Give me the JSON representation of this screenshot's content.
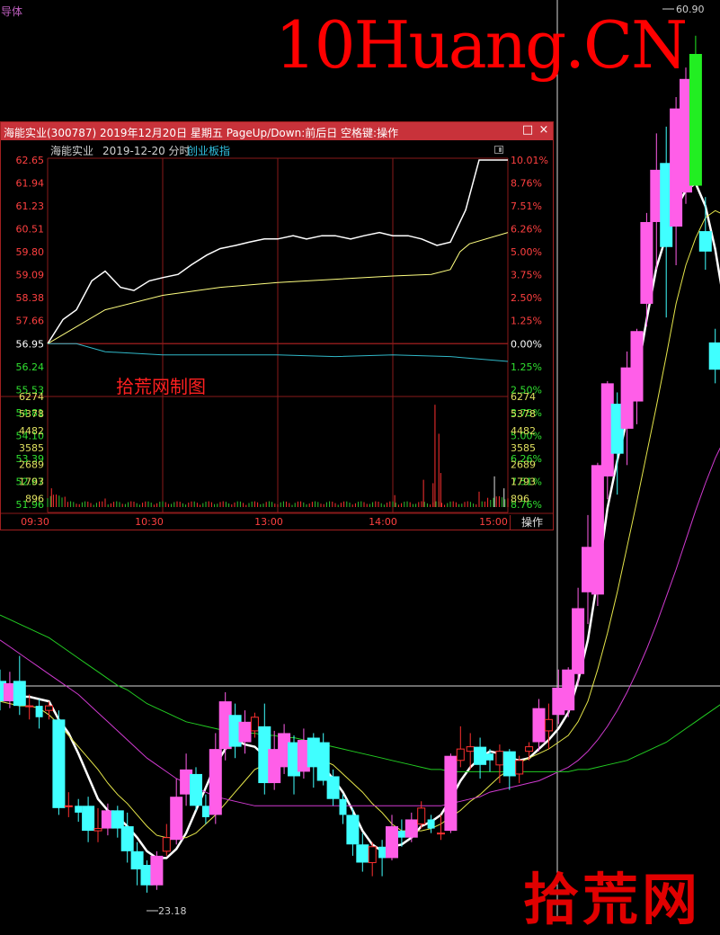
{
  "colors": {
    "up": "#ff3030",
    "down": "#40ffff",
    "big_up": "#ff5ee8",
    "big_down": "#22ee22",
    "ma5": "#ffffff",
    "ma10": "#e6e64a",
    "ma20": "#d03ad0",
    "ma60": "#22cc22",
    "grid": "#8a1a1a",
    "price_line": "#ffffff",
    "avg_line": "#ffff80",
    "index_line": "#30b8c8",
    "up_text": "#ff4040",
    "down_text": "#30e030",
    "neutral_text": "#ffffff",
    "volume_text": "#e0e060"
  },
  "kline": {
    "sector_tag": "导体",
    "max_label": "60.90",
    "min_label": "23.18"
  },
  "watermarks": {
    "top": "10Huang.CN",
    "bottom": "拾荒网"
  },
  "popup": {
    "title": "海能实业(300787) 2019年12月20日 星期五 PageUp/Down:前后日 空格键:操作",
    "stock_name": "海能实业",
    "date": "2019-12-20 分时",
    "index_link": "创业板指",
    "restore_icon": "□",
    "close_icon": "×",
    "stamp": "拾荒网制图",
    "operate_label": "操作",
    "price_axis": [
      "62.65",
      "61.94",
      "61.23",
      "60.51",
      "59.80",
      "59.09",
      "58.38",
      "57.66",
      "56.95",
      "56.24",
      "55.53",
      "54.81",
      "54.10",
      "53.39",
      "52.67",
      "51.96"
    ],
    "pct_axis": [
      "10.01%",
      "8.76%",
      "7.51%",
      "6.26%",
      "5.00%",
      "3.75%",
      "2.50%",
      "1.25%",
      "0.00%",
      "1.25%",
      "2.50%",
      "3.75%",
      "5.00%",
      "6.26%",
      "7.51%",
      "8.76%"
    ],
    "volume_axis": [
      "6274",
      "5378",
      "4482",
      "3585",
      "2689",
      "1793",
      "896"
    ],
    "time_axis": [
      "09:30",
      "10:30",
      "13:00",
      "14:00",
      "15:00"
    ]
  },
  "chart_data": [
    {
      "type": "line",
      "title": "海能实业 2019-12-20 分时",
      "series": [
        {
          "name": "price",
          "x": [
            0,
            8,
            15,
            23,
            30,
            38,
            45,
            53,
            60,
            68,
            75,
            83,
            90,
            98,
            105,
            113,
            120,
            128,
            135,
            143,
            150,
            158,
            165,
            173,
            180,
            188,
            195,
            203,
            210,
            218,
            225,
            233,
            240
          ],
          "values": [
            56.95,
            57.7,
            58.0,
            58.9,
            59.2,
            58.7,
            58.6,
            58.9,
            59.0,
            59.1,
            59.4,
            59.7,
            59.9,
            60.0,
            60.1,
            60.2,
            60.2,
            60.3,
            60.2,
            60.3,
            60.3,
            60.2,
            60.3,
            60.4,
            60.3,
            60.3,
            60.2,
            60.0,
            60.1,
            61.1,
            62.65,
            62.65,
            62.65
          ]
        },
        {
          "name": "avg",
          "x": [
            0,
            30,
            60,
            90,
            120,
            150,
            180,
            200,
            210,
            215,
            220,
            240
          ],
          "values": [
            56.95,
            58.0,
            58.45,
            58.7,
            58.85,
            58.95,
            59.05,
            59.1,
            59.25,
            59.8,
            60.05,
            60.4
          ]
        },
        {
          "name": "index",
          "x": [
            0,
            15,
            30,
            60,
            90,
            120,
            150,
            180,
            210,
            240
          ],
          "values": [
            56.95,
            56.95,
            56.7,
            56.6,
            56.6,
            56.6,
            56.55,
            56.6,
            56.55,
            56.4
          ]
        }
      ],
      "xlabel": "",
      "ylabel": "",
      "ylim": [
        51.25,
        62.65
      ]
    },
    {
      "type": "bar",
      "title": "",
      "xlim": [
        0,
        240
      ],
      "ylim": [
        0,
        6274
      ],
      "spikes": [
        {
          "x": 201,
          "v": 1400
        },
        {
          "x": 202,
          "v": 6000
        },
        {
          "x": 204,
          "v": 4300
        },
        {
          "x": 196,
          "v": 1600
        },
        {
          "x": 205,
          "v": 2000
        },
        {
          "x": 233,
          "v": 1800
        },
        {
          "x": 238,
          "v": 1100
        },
        {
          "x": 2,
          "v": 1100
        },
        {
          "x": 30,
          "v": 500
        },
        {
          "x": 181,
          "v": 700
        },
        {
          "x": 225,
          "v": 900
        }
      ]
    },
    {
      "type": "candlestick",
      "title": "",
      "ylim": [
        22.5,
        62.0
      ],
      "candles": [
        {
          "o": 32.5,
          "c": 31.6,
          "h": 33.0,
          "l": 31.2
        },
        {
          "o": 31.6,
          "c": 32.4,
          "h": 32.9,
          "l": 31.3
        },
        {
          "o": 32.5,
          "c": 31.4,
          "h": 33.6,
          "l": 31.0
        },
        {
          "o": 31.4,
          "c": 31.4,
          "h": 31.9,
          "l": 30.8
        },
        {
          "o": 31.4,
          "c": 30.9,
          "h": 31.7,
          "l": 30.4
        },
        {
          "o": 31.2,
          "c": 31.4,
          "h": 31.6,
          "l": 30.8
        },
        {
          "o": 30.8,
          "c": 26.9,
          "h": 31.2,
          "l": 26.6
        },
        {
          "o": 27.0,
          "c": 27.0,
          "h": 27.6,
          "l": 26.5
        },
        {
          "o": 27.0,
          "c": 26.7,
          "h": 27.3,
          "l": 26.3
        },
        {
          "o": 27.0,
          "c": 25.9,
          "h": 27.4,
          "l": 25.4
        },
        {
          "o": 25.9,
          "c": 26.0,
          "h": 26.9,
          "l": 25.4
        },
        {
          "o": 26.0,
          "c": 26.8,
          "h": 27.1,
          "l": 25.7
        },
        {
          "o": 26.8,
          "c": 26.0,
          "h": 27.0,
          "l": 25.6
        },
        {
          "o": 26.1,
          "c": 25.0,
          "h": 26.7,
          "l": 24.5
        },
        {
          "o": 25.0,
          "c": 24.2,
          "h": 25.4,
          "l": 23.5
        },
        {
          "o": 24.4,
          "c": 23.5,
          "h": 24.6,
          "l": 23.18
        },
        {
          "o": 23.5,
          "c": 24.8,
          "h": 25.0,
          "l": 23.3
        },
        {
          "o": 25.0,
          "c": 25.6,
          "h": 26.2,
          "l": 24.8
        },
        {
          "o": 25.5,
          "c": 27.4,
          "h": 28.2,
          "l": 25.3
        },
        {
          "o": 27.5,
          "c": 28.6,
          "h": 29.3,
          "l": 27.0
        },
        {
          "o": 28.4,
          "c": 27.0,
          "h": 28.7,
          "l": 26.8
        },
        {
          "o": 27.0,
          "c": 26.5,
          "h": 27.5,
          "l": 26.2
        },
        {
          "o": 26.6,
          "c": 29.5,
          "h": 30.2,
          "l": 26.2
        },
        {
          "o": 29.5,
          "c": 31.6,
          "h": 32.0,
          "l": 29.0
        },
        {
          "o": 31.0,
          "c": 29.6,
          "h": 31.5,
          "l": 29.1
        },
        {
          "o": 29.8,
          "c": 30.7,
          "h": 31.2,
          "l": 29.3
        },
        {
          "o": 30.3,
          "c": 30.9,
          "h": 31.1,
          "l": 30.0
        },
        {
          "o": 30.5,
          "c": 28.0,
          "h": 31.5,
          "l": 27.5
        },
        {
          "o": 28.0,
          "c": 29.5,
          "h": 30.3,
          "l": 27.7
        },
        {
          "o": 28.7,
          "c": 30.2,
          "h": 30.6,
          "l": 28.4
        },
        {
          "o": 29.8,
          "c": 28.3,
          "h": 30.1,
          "l": 27.5
        },
        {
          "o": 28.5,
          "c": 29.9,
          "h": 30.4,
          "l": 28.2
        },
        {
          "o": 30.0,
          "c": 28.7,
          "h": 30.2,
          "l": 27.8
        },
        {
          "o": 29.8,
          "c": 28.1,
          "h": 30.2,
          "l": 27.9
        },
        {
          "o": 28.3,
          "c": 27.3,
          "h": 28.6,
          "l": 27.0
        },
        {
          "o": 27.3,
          "c": 26.6,
          "h": 27.5,
          "l": 26.2
        },
        {
          "o": 26.6,
          "c": 25.3,
          "h": 26.9,
          "l": 24.8
        },
        {
          "o": 25.3,
          "c": 24.5,
          "h": 25.8,
          "l": 24.1
        },
        {
          "o": 24.5,
          "c": 25.2,
          "h": 25.4,
          "l": 23.9
        },
        {
          "o": 25.2,
          "c": 24.7,
          "h": 25.5,
          "l": 23.9
        },
        {
          "o": 24.7,
          "c": 26.1,
          "h": 26.6,
          "l": 24.6
        },
        {
          "o": 25.9,
          "c": 25.6,
          "h": 26.4,
          "l": 25.2
        },
        {
          "o": 25.6,
          "c": 26.4,
          "h": 26.7,
          "l": 25.4
        },
        {
          "o": 26.2,
          "c": 26.9,
          "h": 27.2,
          "l": 26.0
        },
        {
          "o": 26.4,
          "c": 26.0,
          "h": 26.6,
          "l": 25.8
        },
        {
          "o": 25.8,
          "c": 25.8,
          "h": 26.6,
          "l": 25.5
        },
        {
          "o": 25.9,
          "c": 29.2,
          "h": 29.3,
          "l": 25.8
        },
        {
          "o": 29.0,
          "c": 29.5,
          "h": 30.5,
          "l": 28.7
        },
        {
          "o": 29.4,
          "c": 29.6,
          "h": 30.2,
          "l": 28.6
        },
        {
          "o": 29.6,
          "c": 28.8,
          "h": 30.0,
          "l": 28.2
        },
        {
          "o": 29.3,
          "c": 29.0,
          "h": 29.5,
          "l": 28.5
        },
        {
          "o": 28.8,
          "c": 29.4,
          "h": 29.7,
          "l": 28.0
        },
        {
          "o": 29.4,
          "c": 28.3,
          "h": 29.5,
          "l": 27.7
        },
        {
          "o": 28.4,
          "c": 29.0,
          "h": 29.2,
          "l": 28.0
        },
        {
          "o": 29.4,
          "c": 29.6,
          "h": 29.8,
          "l": 29.0
        },
        {
          "o": 29.8,
          "c": 31.3,
          "h": 31.7,
          "l": 29.4
        },
        {
          "o": 30.3,
          "c": 30.8,
          "h": 31.5,
          "l": 29.5
        },
        {
          "o": 31.0,
          "c": 32.2,
          "h": 33.0,
          "l": 30.6
        },
        {
          "o": 31.2,
          "c": 33.0,
          "h": 33.1,
          "l": 30.9
        },
        {
          "o": 32.8,
          "c": 35.7,
          "h": 36.6,
          "l": 32.3
        },
        {
          "o": 36.4,
          "c": 38.4,
          "h": 39.8,
          "l": 35.0
        },
        {
          "o": 36.3,
          "c": 42.0,
          "h": 42.1,
          "l": 35.8
        },
        {
          "o": 41.5,
          "c": 45.6,
          "h": 45.7,
          "l": 40.5
        },
        {
          "o": 44.7,
          "c": 42.5,
          "h": 45.2,
          "l": 40.7
        },
        {
          "o": 43.6,
          "c": 46.3,
          "h": 47.0,
          "l": 42.0
        },
        {
          "o": 44.8,
          "c": 47.9,
          "h": 48.0,
          "l": 43.8
        },
        {
          "o": 49.1,
          "c": 52.7,
          "h": 53.1,
          "l": 48.1
        },
        {
          "o": 52.7,
          "c": 55.0,
          "h": 56.6,
          "l": 50.6
        },
        {
          "o": 55.3,
          "c": 51.6,
          "h": 56.9,
          "l": 48.5
        },
        {
          "o": 52.5,
          "c": 57.7,
          "h": 58.2,
          "l": 50.8
        },
        {
          "o": 54.0,
          "c": 59.0,
          "h": 59.5,
          "l": 53.5
        },
        {
          "o": 60.1,
          "c": 54.3,
          "h": 60.9,
          "l": 54.3
        },
        {
          "o": 52.3,
          "c": 51.4,
          "h": 53.8,
          "l": 50.6
        },
        {
          "o": 47.4,
          "c": 46.2,
          "h": 48.0,
          "l": 45.6
        },
        {
          "o": 45.1,
          "c": 44.7,
          "h": 45.6,
          "l": 43.9
        },
        {
          "o": 44.6,
          "c": 45.2,
          "h": 45.5,
          "l": 44.0
        }
      ],
      "ma_series": [
        {
          "name": "MA5",
          "from_index": 0,
          "values": [
            31.7,
            31.7,
            31.8,
            31.8,
            31.7,
            31.6,
            30.8,
            30.2,
            29.3,
            28.3,
            27.3,
            26.8,
            26.5,
            26.1,
            25.6,
            25.0,
            24.7,
            24.7,
            25.1,
            25.8,
            26.8,
            27.8,
            28.8,
            29.5,
            29.9,
            29.7,
            29.6,
            29.2,
            29.0,
            29.0,
            29.0,
            29.0,
            28.9,
            28.7,
            28.2,
            27.6,
            26.8,
            25.9,
            25.3,
            25.0,
            25.2,
            25.3,
            25.6,
            26.1,
            26.3,
            26.6,
            27.3,
            28.1,
            28.7,
            29.1,
            29.4,
            29.3,
            29.1,
            29.0,
            29.1,
            29.5,
            29.9,
            30.4,
            31.1,
            32.5,
            34.3,
            37.0,
            40.1,
            42.2,
            44.0,
            45.9,
            48.4,
            50.7,
            52.1,
            53.3,
            54.1,
            54.4,
            53.4,
            51.5,
            48.9,
            46.3,
            44.6
          ]
        },
        {
          "name": "MA10",
          "from_index": 0,
          "values": [
            31.6,
            31.5,
            31.4,
            31.4,
            31.3,
            31.0,
            30.6,
            30.1,
            29.6,
            29.1,
            28.6,
            28.0,
            27.5,
            27.1,
            26.6,
            26.1,
            25.7,
            25.6,
            25.6,
            25.6,
            25.8,
            26.2,
            26.6,
            27.1,
            27.6,
            28.1,
            28.6,
            28.8,
            29.0,
            29.3,
            29.3,
            29.3,
            29.2,
            29.0,
            28.8,
            28.4,
            28.0,
            27.6,
            27.1,
            26.7,
            26.2,
            25.9,
            25.9,
            25.9,
            26.0,
            26.2,
            26.5,
            26.8,
            27.2,
            27.5,
            27.9,
            28.3,
            28.6,
            28.9,
            29.1,
            29.3,
            29.5,
            29.8,
            30.1,
            30.7,
            31.6,
            33.0,
            34.6,
            36.4,
            38.4,
            40.4,
            42.5,
            44.6,
            46.8,
            49.1,
            50.8,
            52.0,
            52.9,
            53.2,
            53.0,
            52.4,
            51.3
          ]
        },
        {
          "name": "MA20",
          "from_index": 0,
          "values": [
            34.3,
            34.0,
            33.7,
            33.4,
            33.1,
            32.8,
            32.5,
            32.2,
            31.9,
            31.5,
            31.1,
            30.7,
            30.3,
            29.9,
            29.5,
            29.1,
            28.8,
            28.5,
            28.2,
            28.0,
            27.8,
            27.6,
            27.4,
            27.3,
            27.2,
            27.1,
            27.0,
            27.0,
            27.0,
            27.0,
            27.0,
            27.0,
            27.0,
            27.0,
            27.0,
            27.0,
            27.0,
            27.0,
            27.0,
            27.0,
            27.0,
            27.0,
            27.0,
            27.0,
            27.0,
            27.0,
            27.1,
            27.2,
            27.3,
            27.4,
            27.6,
            27.7,
            27.8,
            27.9,
            28.0,
            28.1,
            28.3,
            28.5,
            28.7,
            29.0,
            29.4,
            29.9,
            30.5,
            31.2,
            32.0,
            32.9,
            33.9,
            35.0,
            36.2,
            37.4,
            38.7,
            40.0,
            41.2,
            42.3,
            43.2,
            43.9,
            44.5
          ]
        },
        {
          "name": "MA60",
          "from_index": 0,
          "values": [
            35.4,
            35.2,
            35.0,
            34.8,
            34.6,
            34.4,
            34.1,
            33.8,
            33.5,
            33.2,
            32.9,
            32.6,
            32.3,
            32.1,
            31.8,
            31.5,
            31.3,
            31.1,
            30.9,
            30.7,
            30.6,
            30.5,
            30.4,
            30.3,
            30.3,
            30.2,
            30.2,
            30.1,
            30.1,
            30.0,
            30.0,
            29.9,
            29.8,
            29.7,
            29.6,
            29.5,
            29.4,
            29.3,
            29.2,
            29.1,
            29.0,
            28.9,
            28.8,
            28.7,
            28.6,
            28.6,
            28.5,
            28.5,
            28.5,
            28.5,
            28.5,
            28.5,
            28.5,
            28.5,
            28.5,
            28.5,
            28.5,
            28.5,
            28.5,
            28.6,
            28.6,
            28.7,
            28.8,
            28.9,
            29.0,
            29.2,
            29.4,
            29.6,
            29.8,
            30.1,
            30.4,
            30.7,
            31.0,
            31.3,
            31.6,
            31.9,
            32.2
          ]
        }
      ]
    }
  ]
}
